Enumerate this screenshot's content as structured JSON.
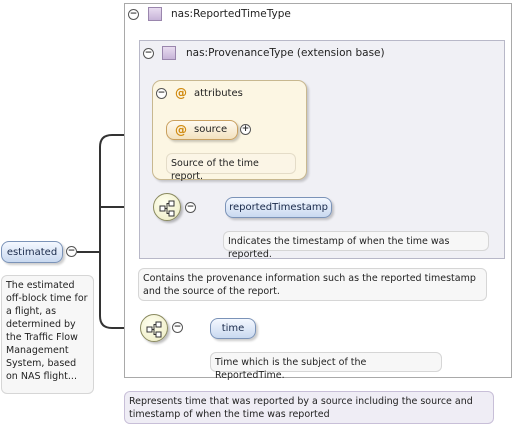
{
  "diagram": {
    "root_element": {
      "name": "estimated",
      "documentation": "The estimated off-block time for a flight, as determined by the Traffic Flow Management System, based on NAS flight..."
    },
    "type": {
      "name": "nas:ReportedTimeType",
      "documentation": "Represents time that was reported by a source including the source and timestamp of when the time was reported"
    },
    "extension": {
      "name": "nas:ProvenanceType (extension base)",
      "documentation": "Contains the provenance information such as the reported timestamp and the source of the report.",
      "attributes_label": "attributes",
      "attribute": {
        "name": "source",
        "documentation": "Source of the time report."
      },
      "element": {
        "name": "reportedTimestamp",
        "documentation": "Indicates the timestamp of when the time was reported."
      }
    },
    "child_element": {
      "name": "time",
      "documentation": "Time which is the subject of the ReportedTime."
    },
    "symbols": {
      "collapse": "⊖",
      "expand": "⊕",
      "attribute_marker": "@"
    },
    "colors": {
      "element_fill": "#c9d9f0",
      "attribute_fill": "#f3e2bf",
      "type_square": "#c7b4d8",
      "connector": "#333333"
    }
  }
}
